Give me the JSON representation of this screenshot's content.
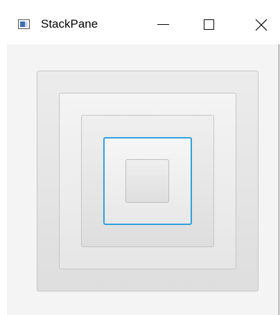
{
  "window": {
    "title": "StackPane",
    "app_icon": "java-app-icon",
    "controls": {
      "minimize": "minimize-icon",
      "maximize": "maximize-icon",
      "close": "close-icon"
    }
  },
  "stack_pane": {
    "layers": 5,
    "focused_layer": 4,
    "colors": {
      "background": "#f4f4f4",
      "box_border": "#c4c4c4",
      "focus_ring": "#2f9fdc"
    }
  }
}
